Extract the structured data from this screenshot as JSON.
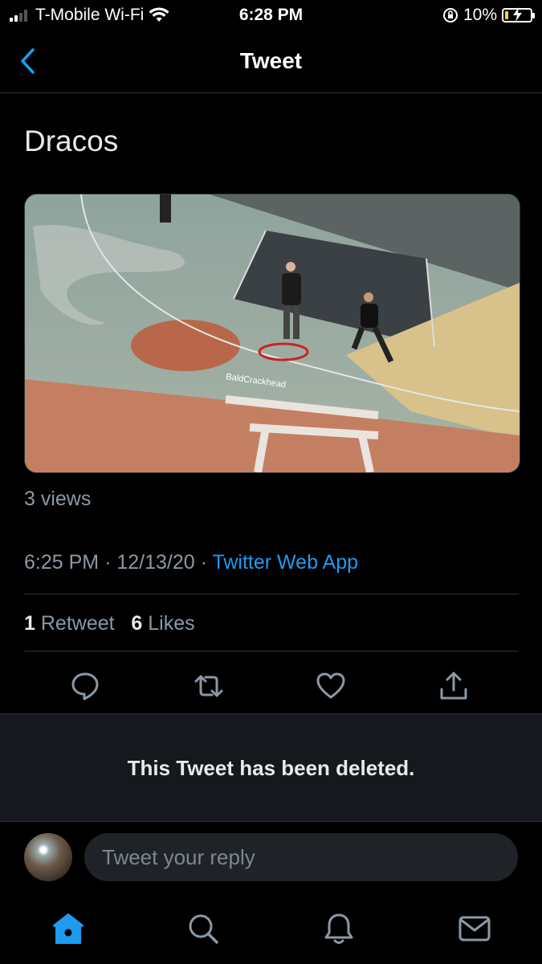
{
  "status_bar": {
    "carrier": "T-Mobile Wi-Fi",
    "time": "6:28 PM",
    "battery": "10%"
  },
  "header": {
    "title": "Tweet"
  },
  "tweet": {
    "text": "Dracos",
    "video_overlay_text": "BaldCrackhead",
    "views": "3 views",
    "time": "6:25 PM",
    "date": "12/13/20",
    "source": "Twitter Web App",
    "retweet_count": "1",
    "retweet_label": "Retweet",
    "like_count": "6",
    "like_label": "Likes"
  },
  "actions": [
    "reply-icon",
    "retweet-icon",
    "like-icon",
    "share-icon"
  ],
  "deleted_notice": "This Tweet has been deleted.",
  "reply": {
    "placeholder": "Tweet your reply"
  },
  "tabs": [
    "home-icon",
    "search-icon",
    "notifications-icon",
    "messages-icon"
  ],
  "colors": {
    "accent": "#1d9bf0",
    "background": "#000000",
    "secondary_text": "#8b98a5"
  }
}
